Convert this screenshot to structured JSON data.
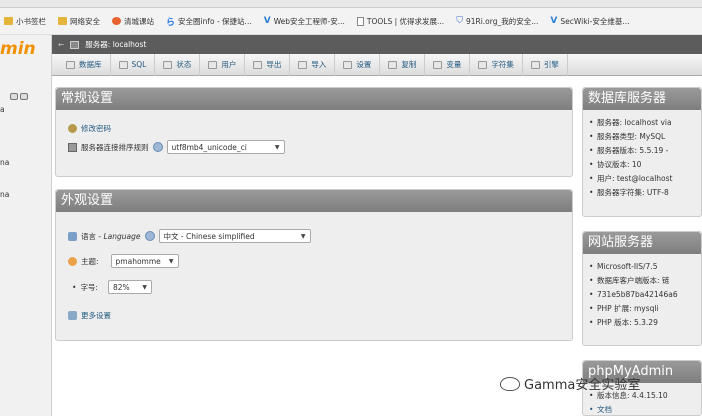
{
  "bookmarks": [
    {
      "icon": "folder-icon",
      "label": "小书签栏"
    },
    {
      "icon": "folder-icon",
      "label": "网络安全"
    },
    {
      "icon": "brand-c-icon",
      "label": "清城课站"
    },
    {
      "icon": "s-icon",
      "label": "安全圈info - 保捷站..."
    },
    {
      "icon": "v-icon",
      "label": "Web安全工程师-安..."
    },
    {
      "icon": "doc-icon",
      "label": "TOOLS | 优得求发展..."
    },
    {
      "icon": "shield-icon",
      "label": "91Ri.org_我的安全..."
    },
    {
      "icon": "v-icon",
      "label": "SecWiki-安全维基..."
    }
  ],
  "left_nav": {
    "logo": "min",
    "items": [
      "a",
      "na",
      "na"
    ]
  },
  "topbar": {
    "server_label": "服务器: localhost"
  },
  "tabs": [
    {
      "icon": "database-icon",
      "label": "数据库"
    },
    {
      "icon": "sql-icon",
      "label": "SQL"
    },
    {
      "icon": "status-icon",
      "label": "状态"
    },
    {
      "icon": "users-icon",
      "label": "用户"
    },
    {
      "icon": "export-icon",
      "label": "导出"
    },
    {
      "icon": "import-icon",
      "label": "导入"
    },
    {
      "icon": "settings-icon",
      "label": "设置"
    },
    {
      "icon": "replication-icon",
      "label": "复制"
    },
    {
      "icon": "variables-icon",
      "label": "变量"
    },
    {
      "icon": "charset-icon",
      "label": "字符集"
    },
    {
      "icon": "engine-icon",
      "label": "引擎"
    }
  ],
  "general": {
    "title": "常规设置",
    "change_password": "修改密码",
    "collation_label": "服务器连接排序规则",
    "collation_value": "utf8mb4_unicode_ci"
  },
  "appearance": {
    "title": "外观设置",
    "language_label": "语言 - ",
    "language_label_en": "Language",
    "language_value": "中文 - Chinese simplified",
    "theme_label": "主题:",
    "theme_value": "pmahomme",
    "fontsize_label": "字号:",
    "fontsize_value": "82%",
    "more_settings": "更多设置"
  },
  "db_server": {
    "title": "数据库服务器",
    "items": [
      "服务器: localhost via",
      "服务器类型: MySQL",
      "服务器版本: 5.5.19 -",
      "协议版本: 10",
      "用户: test@localhost",
      "服务器字符集: UTF-8"
    ]
  },
  "web_server": {
    "title": "网站服务器",
    "items": [
      "Microsoft-IIS/7.5",
      "数据库客户端版本: 链",
      "731e5b87ba42146a6",
      "PHP 扩展: mysqli",
      "PHP 版本: 5.3.29"
    ]
  },
  "pma": {
    "title": "phpMyAdmin",
    "items": [
      "版本信息: 4.4.15.10",
      "文档"
    ]
  },
  "watermark": "Gamma安全实验室"
}
